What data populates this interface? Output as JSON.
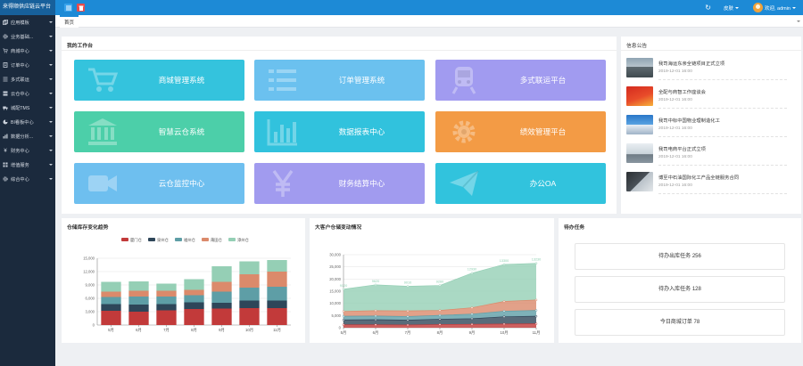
{
  "app": {
    "title": "来得顺供应链云平台"
  },
  "topbar": {
    "skin_label": "皮肤",
    "user_label": "欢迎, admin"
  },
  "sidebar": {
    "items": [
      {
        "label": "应用模板",
        "icon": "copy-icon"
      },
      {
        "label": "业务基础...",
        "icon": "gear-icon"
      },
      {
        "label": "商城中心",
        "icon": "cart-icon"
      },
      {
        "label": "订单中心",
        "icon": "document-icon"
      },
      {
        "label": "多式联运",
        "icon": "list-icon"
      },
      {
        "label": "云仓中心",
        "icon": "server-icon"
      },
      {
        "label": "城配TMS",
        "icon": "truck-icon"
      },
      {
        "label": "BI看板中心",
        "icon": "pie-icon"
      },
      {
        "label": "数据分析...",
        "icon": "bar-chart-icon"
      },
      {
        "label": "财务中心",
        "icon": "yen-icon"
      },
      {
        "label": "增值服务",
        "icon": "grid-icon"
      },
      {
        "label": "综合中心",
        "icon": "cog-icon"
      }
    ]
  },
  "tabs": {
    "home": "首页"
  },
  "workspace": {
    "title": "我的工作台",
    "tiles": [
      {
        "label": "商城管理系统",
        "color": "#34c3dd",
        "icon": "cart-icon"
      },
      {
        "label": "订单管理系统",
        "color": "#6bc1ef",
        "icon": "list-icon"
      },
      {
        "label": "多式联运平台",
        "color": "#a19bf0",
        "icon": "train-icon"
      },
      {
        "label": "智慧云仓系统",
        "color": "#4ccfa9",
        "icon": "bank-icon"
      },
      {
        "label": "数据报表中心",
        "color": "#31c2dd",
        "icon": "bar-chart-icon"
      },
      {
        "label": "绩效管理平台",
        "color": "#f39b45",
        "icon": "gear-icon"
      },
      {
        "label": "云仓监控中心",
        "color": "#6ebfef",
        "icon": "video-icon"
      },
      {
        "label": "财务结算中心",
        "color": "#a19bef",
        "icon": "yen-icon"
      },
      {
        "label": "办公OA",
        "color": "#31c3dd",
        "icon": "paper-plane-icon"
      }
    ]
  },
  "news": {
    "title": "信息公告",
    "items": [
      {
        "title": "我司海运东亲全链项目正式立项",
        "date": "2019-12-01 16:00"
      },
      {
        "title": "全配与商智工作座谈会",
        "date": "2019-12-01 16:00"
      },
      {
        "title": "我司中标中国物业理制造化工",
        "date": "2019-12-01 16:00"
      },
      {
        "title": "我司电商平台正式立项",
        "date": "2019-12-01 16:00"
      },
      {
        "title": "博至中石油国际化工产品全链服务合同",
        "date": "2019-12-01 16:00"
      }
    ]
  },
  "charts": {
    "bar": {
      "title": "仓储库存变化趋势"
    },
    "area": {
      "title": "大客户仓储变动情况"
    }
  },
  "tasks": {
    "title": "待办任务",
    "items": [
      {
        "label": "待办出库任务 256"
      },
      {
        "label": "待办入库任务 128"
      },
      {
        "label": "今日商城订单 78"
      }
    ]
  },
  "chart_data": [
    {
      "type": "bar",
      "title": "仓储库存变化趋势",
      "stacked": true,
      "categories": [
        "5月",
        "6月",
        "7月",
        "8月",
        "9月",
        "10月",
        "11月"
      ],
      "ylim": [
        0,
        15000
      ],
      "yticks": [
        0,
        3000,
        6000,
        9000,
        12000,
        15000
      ],
      "legend_position": "top",
      "series": [
        {
          "name": "厦门仓",
          "color": "#c23a3a",
          "values": [
            3200,
            3000,
            3300,
            3600,
            3700,
            3800,
            3800
          ]
        },
        {
          "name": "泉州仓",
          "color": "#2e4659",
          "values": [
            1500,
            1600,
            1400,
            1500,
            1300,
            1700,
            1700
          ]
        },
        {
          "name": "福州仓",
          "color": "#5e9ea6",
          "values": [
            1600,
            1800,
            1700,
            1600,
            2500,
            2900,
            3100
          ]
        },
        {
          "name": "莆田仓",
          "color": "#db8a6b",
          "values": [
            1200,
            1300,
            1300,
            1200,
            2200,
            3000,
            3400
          ]
        },
        {
          "name": "漳州仓",
          "color": "#95cfb5",
          "values": [
            2200,
            2100,
            1600,
            2400,
            3500,
            2900,
            2600
          ]
        }
      ]
    },
    {
      "type": "area",
      "title": "大客户仓储变动情况",
      "stacked": true,
      "categories": [
        "5月",
        "6月",
        "7月",
        "8月",
        "9月",
        "10月",
        "11月"
      ],
      "ylim": [
        0,
        30000
      ],
      "yticks": [
        0,
        5000,
        10000,
        15000,
        20000,
        25000,
        30000
      ],
      "series": [
        {
          "color": "#c23a3a",
          "values": [
            1200,
            1200,
            1100,
            1300,
            1400,
            1500,
            1600
          ]
        },
        {
          "color": "#2e4659",
          "values": [
            2000,
            2100,
            2000,
            2200,
            2300,
            3000,
            3100
          ]
        },
        {
          "color": "#5e9ea6",
          "values": [
            1500,
            1500,
            1500,
            1600,
            1900,
            2300,
            2400
          ]
        },
        {
          "color": "#db8a6b",
          "values": [
            2000,
            2200,
            2300,
            2000,
            2600,
            4000,
            4300
          ]
        },
        {
          "color": "#95cfb5",
          "values": [
            9120,
            10620,
            10100,
            10260,
            14230,
            15200,
            15050
          ],
          "labels": [
            "9120",
            "9620",
            "9010",
            "9260",
            "12930",
            "13300",
            "13230"
          ]
        }
      ]
    }
  ],
  "colors": {
    "primary": "#1d8ad6",
    "sidebar": "#1b2a3d",
    "brand": "#17609b"
  }
}
